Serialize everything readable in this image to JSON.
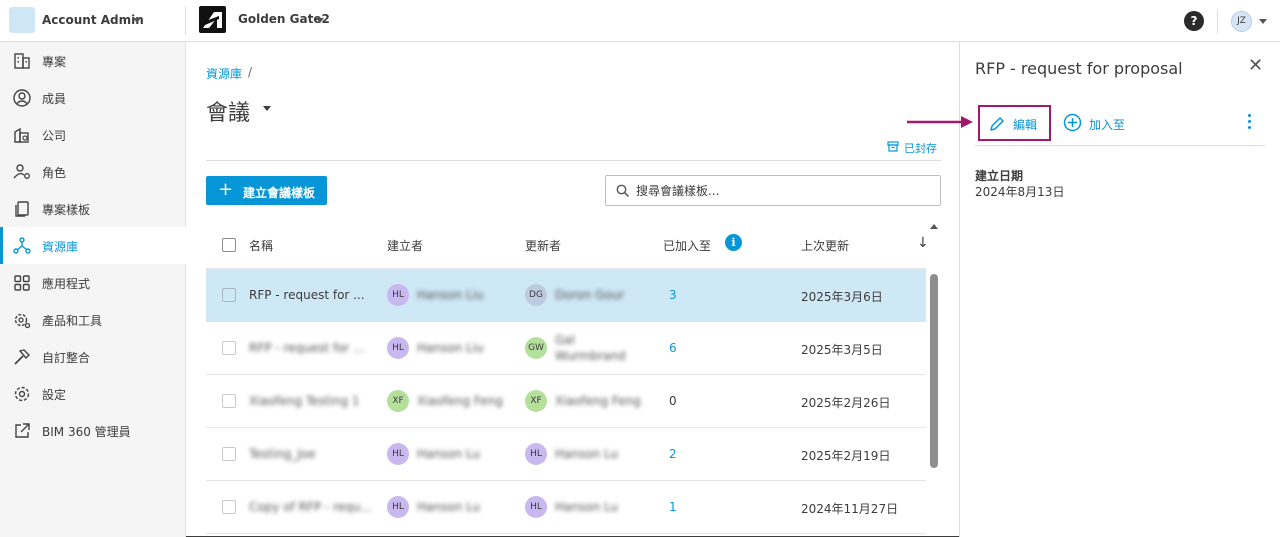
{
  "header": {
    "account_name": "Account Admin",
    "project_name": "Golden Gate2",
    "help_glyph": "?",
    "user_initials": "JZ"
  },
  "sidebar": {
    "items": [
      {
        "label": "專案",
        "icon": "building-icon",
        "active": false
      },
      {
        "label": "成員",
        "icon": "user-circle-icon",
        "active": false
      },
      {
        "label": "公司",
        "icon": "company-icon",
        "active": false
      },
      {
        "label": "角色",
        "icon": "role-icon",
        "active": false
      },
      {
        "label": "專案樣板",
        "icon": "template-icon",
        "active": false
      },
      {
        "label": "資源庫",
        "icon": "library-icon",
        "active": true
      },
      {
        "label": "應用程式",
        "icon": "apps-grid-icon",
        "active": false
      },
      {
        "label": "產品和工具",
        "icon": "gear-tools-icon",
        "active": false
      },
      {
        "label": "自訂整合",
        "icon": "hammer-icon",
        "active": false
      },
      {
        "label": "設定",
        "icon": "settings-icon",
        "active": false
      },
      {
        "label": "BIM 360 管理員",
        "icon": "external-link-icon",
        "active": false
      }
    ]
  },
  "main": {
    "breadcrumb": "資源庫",
    "breadcrumb_sep": "/",
    "title": "會議",
    "archived_label": "已封存",
    "create_button": "建立會議樣板",
    "create_plus": "+",
    "search_placeholder": "搜尋會議樣板...",
    "columns": {
      "name": "名稱",
      "creator": "建立者",
      "updater": "更新者",
      "added_to": "已加入至",
      "updated": "上次更新"
    },
    "rows": [
      {
        "name": "RFP - request for ...",
        "creator_initials": "HL",
        "creator": "Hanson Liu",
        "updater_initials": "DG",
        "updater": "Doron Gour",
        "added_to": "3",
        "updated": "2025年3月6日",
        "selected": true
      },
      {
        "name": "RFP - request for ...",
        "creator_initials": "HL",
        "creator": "Hanson Liu",
        "updater_initials": "GW",
        "updater": "Gal Wurmbrand",
        "added_to": "6",
        "updated": "2025年3月5日",
        "selected": false
      },
      {
        "name": "Xiaofeng Testing 1",
        "creator_initials": "XF",
        "creator": "Xiaofeng Feng",
        "updater_initials": "XF",
        "updater": "Xiaofeng Feng",
        "added_to": "0",
        "updated": "2025年2月26日",
        "selected": false
      },
      {
        "name": "Testing_Joe",
        "creator_initials": "HL",
        "creator": "Hanson Lu",
        "updater_initials": "HL",
        "updater": "Hanson Lu",
        "added_to": "2",
        "updated": "2025年2月19日",
        "selected": false
      },
      {
        "name": "Copy of RFP - requ...",
        "creator_initials": "HL",
        "creator": "Hanson Lu",
        "updater_initials": "HL",
        "updater": "Hanson Lu",
        "added_to": "1",
        "updated": "2024年11月27日",
        "selected": false
      }
    ]
  },
  "panel": {
    "title": "RFP - request for proposal",
    "edit_label": "編輯",
    "add_to_label": "加入至",
    "created_label": "建立日期",
    "created_value": "2024年8月13日"
  },
  "colors": {
    "accent": "#0696d7",
    "highlight_border": "#a3186f",
    "selected_row": "#cfe8f5"
  }
}
